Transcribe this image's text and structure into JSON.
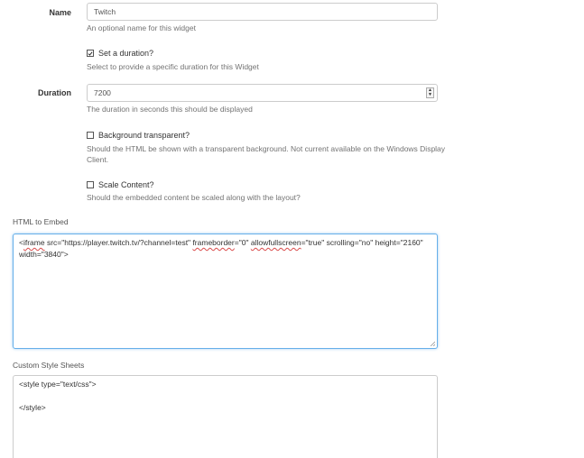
{
  "name_field": {
    "label": "Name",
    "value": "Twitch",
    "help": "An optional name for this widget"
  },
  "set_duration": {
    "label": "Set a duration?",
    "checked": true,
    "help": "Select to provide a specific duration for this Widget"
  },
  "duration_field": {
    "label": "Duration",
    "value": "7200",
    "help": "The duration in seconds this should be displayed"
  },
  "background_transparent": {
    "label": "Background transparent?",
    "checked": false,
    "help_line1": "Should the HTML be shown with a transparent background. Not current available on the Windows Display",
    "help_line2": "Client."
  },
  "scale_content": {
    "label": "Scale Content?",
    "checked": false,
    "help": "Should the embedded content be scaled along with the layout?"
  },
  "html_embed": {
    "label": "HTML to Embed",
    "code_parts": {
      "p1": "<",
      "p2": "iframe",
      "p3": " src=\"https://player.twitch.tv/?channel=test\" ",
      "p4": "frameborder",
      "p5": "=\"0\" ",
      "p6": "allowfullscreen",
      "p7": "=\"true\" scrolling=\"no\" height=\"2160\"",
      "line2": "width=\"3840\">"
    }
  },
  "custom_css": {
    "label": "Custom Style Sheets",
    "line1": "<style type=\"text/css\">",
    "line2": "</style>"
  },
  "colors": {
    "focus_border": "#66afe9",
    "input_border": "#cccccc",
    "help_text": "#737373",
    "spellcheck": "#d94a4a"
  }
}
